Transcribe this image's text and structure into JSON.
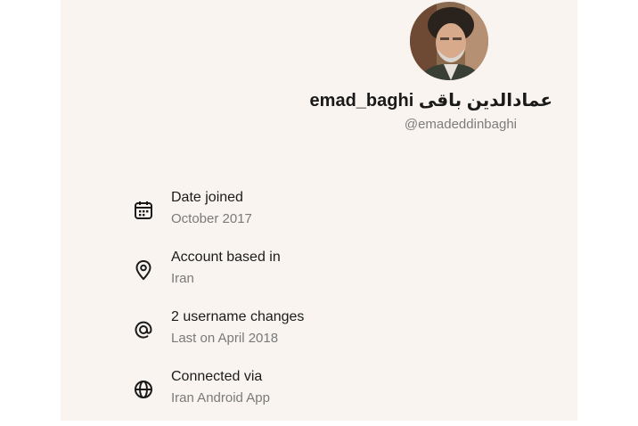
{
  "profile": {
    "display_name": "emad_baghi عمادالدین باقی",
    "handle": "@emadeddinbaghi",
    "avatar_icon": "profile-photo"
  },
  "info": [
    {
      "icon": "calendar-icon",
      "label": "Date joined",
      "value": "October 2017"
    },
    {
      "icon": "location-pin-icon",
      "label": "Account based in",
      "value": "Iran"
    },
    {
      "icon": "at-sign-icon",
      "label": "2 username changes",
      "value": "Last on April 2018"
    },
    {
      "icon": "globe-icon",
      "label": "Connected via",
      "value": "Iran Android App"
    }
  ],
  "colors": {
    "card_background": "#f9f4ef",
    "text_primary": "#1b1b1b",
    "text_secondary": "#7a7a7a"
  }
}
